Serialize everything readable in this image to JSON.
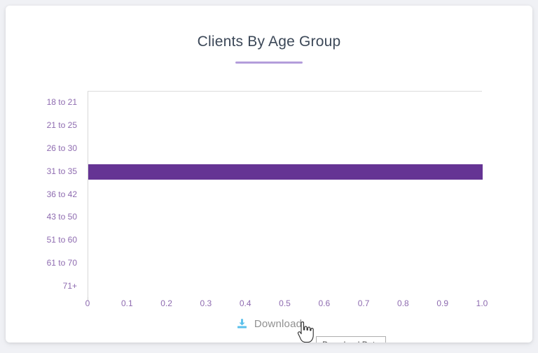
{
  "card": {
    "title": "Clients By Age Group"
  },
  "chart_data": {
    "type": "bar",
    "orientation": "horizontal",
    "title": "Clients By Age Group",
    "xlabel": "",
    "ylabel": "",
    "categories": [
      "18 to 21",
      "21 to 25",
      "26 to 30",
      "31 to 35",
      "36 to 42",
      "43 to 50",
      "51 to 60",
      "61 to 70",
      "71+"
    ],
    "values": [
      0,
      0,
      0,
      1.0,
      0,
      0,
      0,
      0,
      0
    ],
    "xlim": [
      0,
      1.0
    ],
    "xticks": [
      "0",
      "0.1",
      "0.2",
      "0.3",
      "0.4",
      "0.5",
      "0.6",
      "0.7",
      "0.8",
      "0.9",
      "1.0"
    ],
    "xtick_values": [
      0,
      0.1,
      0.2,
      0.3,
      0.4,
      0.5,
      0.6,
      0.7,
      0.8,
      0.9,
      1.0
    ],
    "grid": false,
    "legend": null,
    "bar_color": "#653494",
    "tick_label_color": "#8e6bb0"
  },
  "footer": {
    "download_label": "Download",
    "download_icon": "download-icon",
    "tooltip_text": "Download Data"
  },
  "colors": {
    "page_background": "#f0f1f5",
    "card_background": "#ffffff",
    "title_text": "#3c4858",
    "title_underline": "#b39ddb",
    "bar": "#653494",
    "axis_label": "#8e6bb0",
    "download_icon": "#5bc0eb",
    "download_text": "#909090",
    "tooltip_border": "#aeaeae"
  }
}
